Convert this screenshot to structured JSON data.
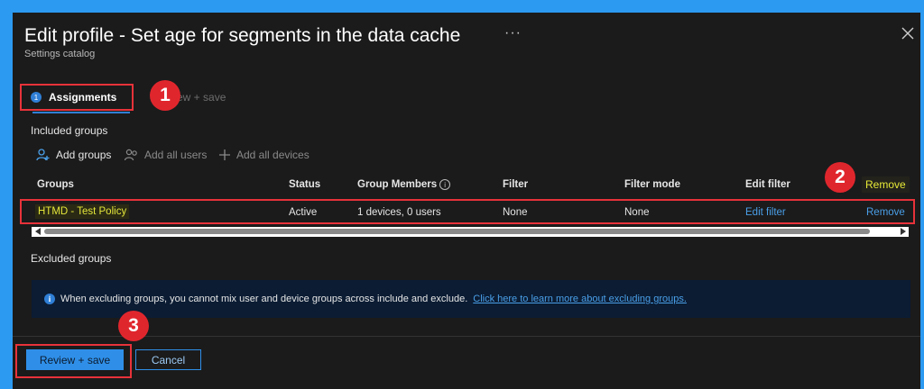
{
  "header": {
    "title": "Edit profile - Set age for segments in the data cache",
    "subtitle": "Settings catalog",
    "more": "···",
    "close_icon": "close-icon"
  },
  "wizard": {
    "steps": [
      {
        "number": "1",
        "label": "Assignments"
      },
      {
        "label": "Review + save"
      }
    ],
    "step2_visible_text": "ew + save"
  },
  "callouts": [
    "1",
    "2",
    "3"
  ],
  "included": {
    "title": "Included groups",
    "commands": [
      {
        "label": "Add groups",
        "icon": "add-user-icon"
      },
      {
        "label": "Add all users",
        "icon": "users-icon"
      },
      {
        "label": "Add all devices",
        "icon": "plus-icon"
      }
    ],
    "columns": [
      "Groups",
      "Status",
      "Group Members",
      "Filter",
      "Filter mode",
      "Edit filter",
      "Remove"
    ],
    "rows": [
      {
        "group": "HTMD - Test Policy",
        "status": "Active",
        "members": "1 devices, 0 users",
        "filter": "None",
        "filter_mode": "None",
        "edit_filter": "Edit filter",
        "remove": "Remove"
      }
    ]
  },
  "excluded": {
    "title": "Excluded groups",
    "info_text": "When excluding groups, you cannot mix user and device groups across include and exclude.",
    "info_link": "Click here to learn more about excluding groups."
  },
  "footer": {
    "primary_label": "Review + save",
    "secondary_label": "Cancel"
  },
  "colors": {
    "background": "#1b1b1b",
    "accent": "#2f8fe8",
    "callout": "#e0262d",
    "highlight_text": "#e4e63a"
  }
}
